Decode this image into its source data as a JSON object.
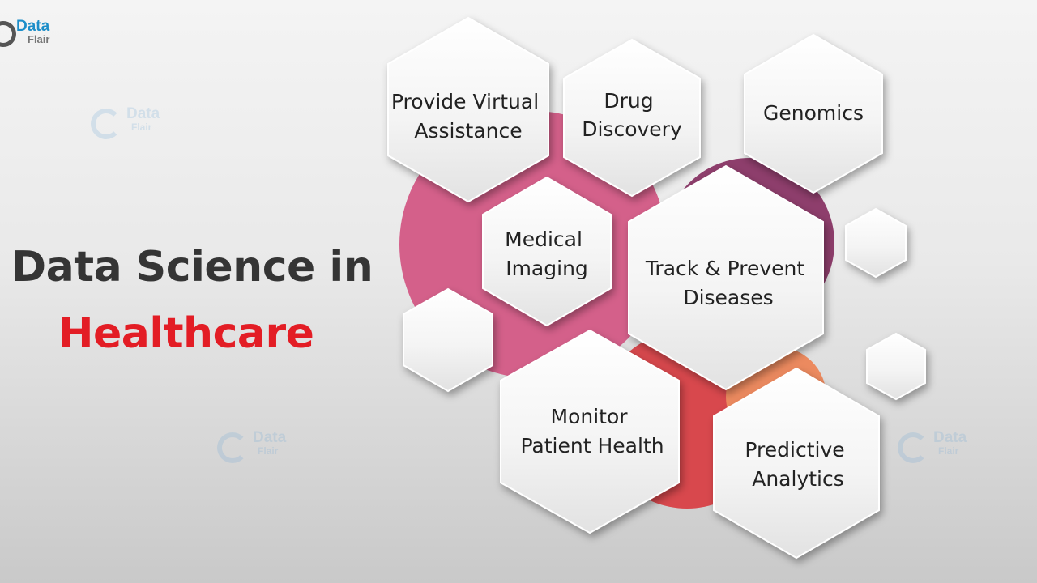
{
  "logo": {
    "line1": "Data",
    "line2": "Flair"
  },
  "watermark": {
    "line1": "Data",
    "line2": "Flair"
  },
  "heading": {
    "line1": "Data Science in",
    "line2": "Healthcare"
  },
  "colors": {
    "title": "#353535",
    "accent": "#e31d25",
    "circle_pink": "#d4608a",
    "circle_plum": "#8e3e6c",
    "circle_red": "#d8484d",
    "circle_orange": "#ec8a5f"
  },
  "nodes": [
    {
      "id": "virtual-assistance",
      "lines": [
        "Provide Virtual",
        "Assistance"
      ]
    },
    {
      "id": "drug-discovery",
      "lines": [
        "Drug",
        "Discovery"
      ]
    },
    {
      "id": "genomics",
      "lines": [
        "Genomics"
      ]
    },
    {
      "id": "medical-imaging",
      "lines": [
        "Medical",
        "Imaging"
      ]
    },
    {
      "id": "track-prevent",
      "lines": [
        "Track & Prevent",
        "Diseases"
      ]
    },
    {
      "id": "monitor-health",
      "lines": [
        "Monitor",
        "Patient Health"
      ]
    },
    {
      "id": "predictive-analytics",
      "lines": [
        "Predictive",
        "Analytics"
      ]
    }
  ]
}
